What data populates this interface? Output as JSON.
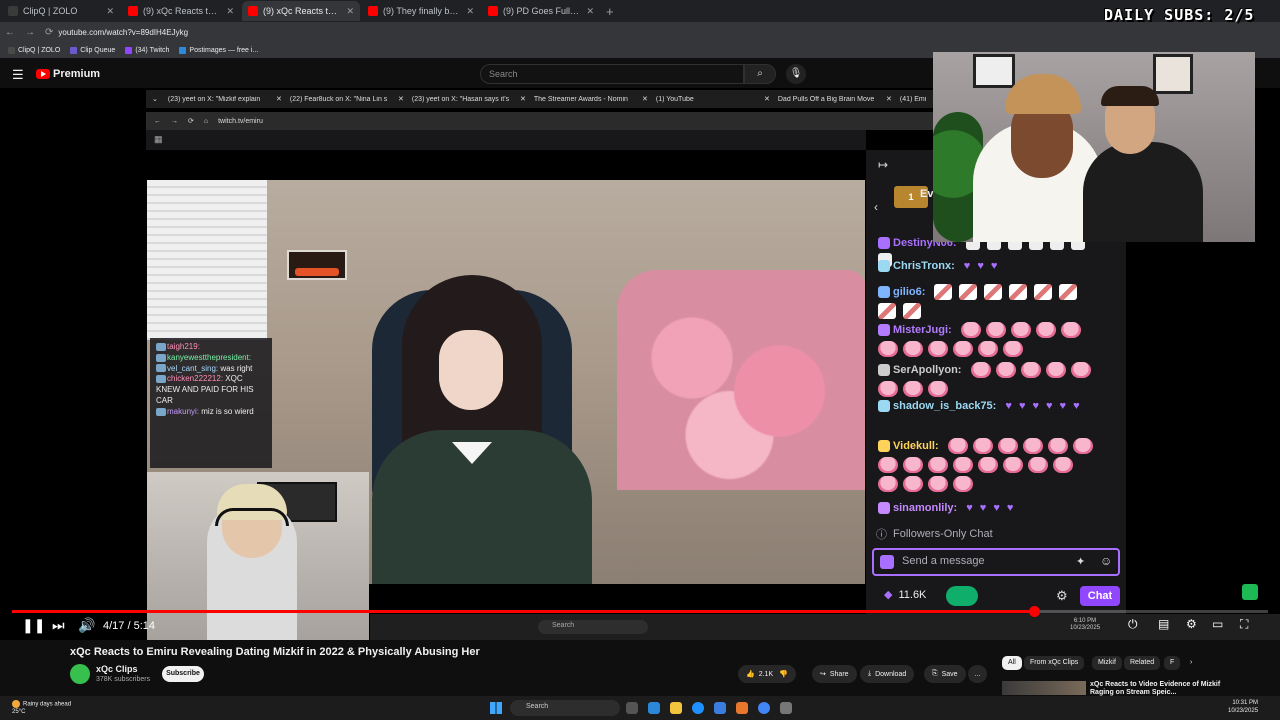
{
  "browser": {
    "tabs": [
      {
        "label": "ClipQ | ZOLO",
        "color": "#3a3a3a"
      },
      {
        "label": "(9) xQc Reacts to Emiru Accusin",
        "color": "#ff0000"
      },
      {
        "label": "(9) xQc Reacts to Emiru Rev",
        "color": "#ff0000",
        "active": true
      },
      {
        "label": "(9) They finally banned her. - Y",
        "color": "#ff0000"
      },
      {
        "label": "(9) PD Goes Full Hades Mode V",
        "color": "#ff0000"
      }
    ],
    "new_tab": "+",
    "url": "youtube.com/watch?v=89dIH4EJykg",
    "bookmarks": [
      {
        "label": "ClipQ | ZOLO",
        "color": "#4a4a4a"
      },
      {
        "label": "Clip Queue",
        "color": "#6a5acd"
      },
      {
        "label": "(34) Twitch",
        "color": "#9147ff"
      },
      {
        "label": "Postimages — free i...",
        "color": "#2e8bdb"
      }
    ]
  },
  "youtube": {
    "brand": "Premium",
    "search_placeholder": "Search"
  },
  "inner_browser": {
    "tabs": [
      {
        "label": "(23) yeet on X: \"Mizkif explain"
      },
      {
        "label": "(22) Fear8uck on X: \"Nina Lin s"
      },
      {
        "label": "(23) yeet on X: \"Hasan says it's"
      },
      {
        "label": "The Streamer Awards - Nomin"
      },
      {
        "label": "(1) YouTube"
      },
      {
        "label": "Dad Pulls Off a Big Brain Move"
      },
      {
        "label": "(41) Emi"
      }
    ],
    "url": "twitch.tv/emiru"
  },
  "mini_chat": {
    "lines": [
      {
        "user": "taigh219:",
        "text": "",
        "cls": "u1"
      },
      {
        "user": "kanyewestthepresident:",
        "text": "",
        "cls": "u2"
      },
      {
        "user": "vel_cant_sing:",
        "text": "was right",
        "cls": "u3"
      },
      {
        "user": "chicken222212:",
        "text": "XQC KNEW AND PAID FOR HIS CAR",
        "cls": "u1"
      },
      {
        "user": "makunyi:",
        "text": "miz is so wierd",
        "cls": "u4"
      }
    ]
  },
  "twitch_chat": {
    "ev_label": "Ev",
    "messages": [
      {
        "user": "DestinyN06:",
        "color": "#a970ff",
        "emote": "cat",
        "count": 7
      },
      {
        "user": "ChrisTronx:",
        "color": "#9bd9f2",
        "emote": "heart",
        "count": 3
      },
      {
        "user": "gilio6:",
        "color": "#7fb5ff",
        "emote": "vgif",
        "count": 8
      },
      {
        "user": "MisterJugi:",
        "color": "#b37cff",
        "emote": "kirby",
        "count": 11
      },
      {
        "user": "SerApollyon:",
        "color": "#cccccc",
        "emote": "kirby",
        "count": 8
      },
      {
        "user": "shadow_is_back75:",
        "color": "#9bd9f2",
        "emote": "heart",
        "count": 6
      },
      {
        "user": "Videkull:",
        "color": "#ffd25a",
        "emote": "kirby",
        "count": 18
      },
      {
        "user": "sinamonlily:",
        "color": "#c58aff",
        "emote": "heart",
        "count": 4
      }
    ],
    "followers_only": "Followers-Only Chat",
    "send_placeholder": "Send a message",
    "bits": "11.6K",
    "chat_button": "Chat"
  },
  "overlay": {
    "daily_subs": "DAILY SUBS: 2/5"
  },
  "player": {
    "time": "4/17 / 5:14",
    "progress": 0.814
  },
  "inner_taskbar": {
    "search": "Search",
    "time": "6:10 PM",
    "date": "10/23/2025"
  },
  "video": {
    "title": "xQc Reacts to Emiru Revealing Dating Mizkif in 2022 & Physically Abusing Her",
    "channel": "xQc Clips",
    "subscribers": "378K subscribers",
    "subscribe": "Subscribe",
    "likes": "2.1K",
    "share": "Share",
    "download": "Download",
    "save": "Save",
    "more": "…"
  },
  "sidebar_chips": [
    {
      "label": "All",
      "selected": true
    },
    {
      "label": "From xQc Clips"
    },
    {
      "label": "Mizkif"
    },
    {
      "label": "Related"
    },
    {
      "label": "F"
    }
  ],
  "related": {
    "title": "xQc Reacts to Video Evidence of Mizkif Raging on Stream Speic..."
  },
  "taskbar": {
    "weather_line1": "Rainy days ahead",
    "weather_line2": "25°C",
    "search": "Search",
    "time": "10:31 PM",
    "date": "10/23/2025"
  }
}
